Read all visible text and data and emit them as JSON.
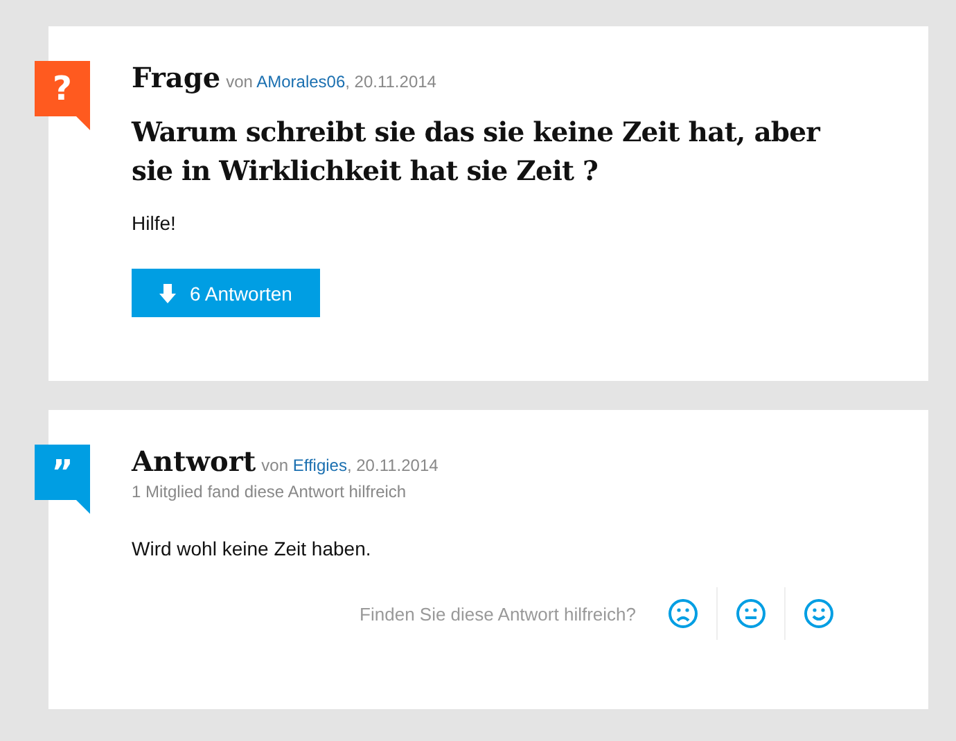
{
  "posts": [
    {
      "kind": "question",
      "symbol": "?",
      "heading": "Frage",
      "by": "von",
      "author": "AMorales06",
      "date": ", 20.11.2014",
      "title": "Warum schreibt sie das sie keine Zeit hat, aber sie in Wirklichkeit hat sie Zeit ?",
      "body": "Hilfe!",
      "answers_button": "6 Antworten"
    },
    {
      "kind": "answer",
      "symbol": "”",
      "heading": "Antwort",
      "by": "von",
      "author": "Effigies",
      "date": ", 20.11.2014",
      "helpful_note": "1 Mitglied fand diese Antwort hilfreich",
      "body": "Wird wohl keine Zeit haben.",
      "rating_prompt": "Finden Sie diese Antwort hilfreich?"
    }
  ]
}
